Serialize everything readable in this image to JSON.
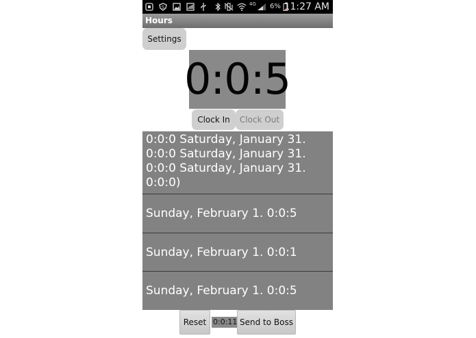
{
  "status_bar": {
    "icons": [
      "notification-icon",
      "shield-icon",
      "image-icon",
      "signal-strength-icon",
      "usb-icon",
      "bluetooth-icon",
      "vibrate-icon",
      "wifi-icon",
      "network-4g-icon",
      "cell-signal-icon"
    ],
    "network_label": "4G",
    "battery": "6%",
    "time": "11:27 AM"
  },
  "app": {
    "title": "Hours"
  },
  "buttons": {
    "settings": "Settings",
    "clock_in": "Clock In",
    "clock_out": "Clock Out",
    "reset": "Reset",
    "send_to_boss": "Send to Boss"
  },
  "timer": {
    "value": "0:0:5"
  },
  "log": {
    "first": "0:0:0 Saturday, January 31.\n0:0:0 Saturday, January 31.\n0:0:0 Saturday, January 31.\n0:0:0)",
    "rows": [
      "Sunday, February 1. 0:0:5",
      "Sunday, February 1. 0:0:1",
      "Sunday, February 1. 0:0:5"
    ]
  },
  "total": {
    "value": "0:0:11"
  },
  "colors": {
    "status_bar": "#000000",
    "list_bg": "#828282",
    "timer_bg": "#898989",
    "button_bg": "#cfcfcf"
  }
}
